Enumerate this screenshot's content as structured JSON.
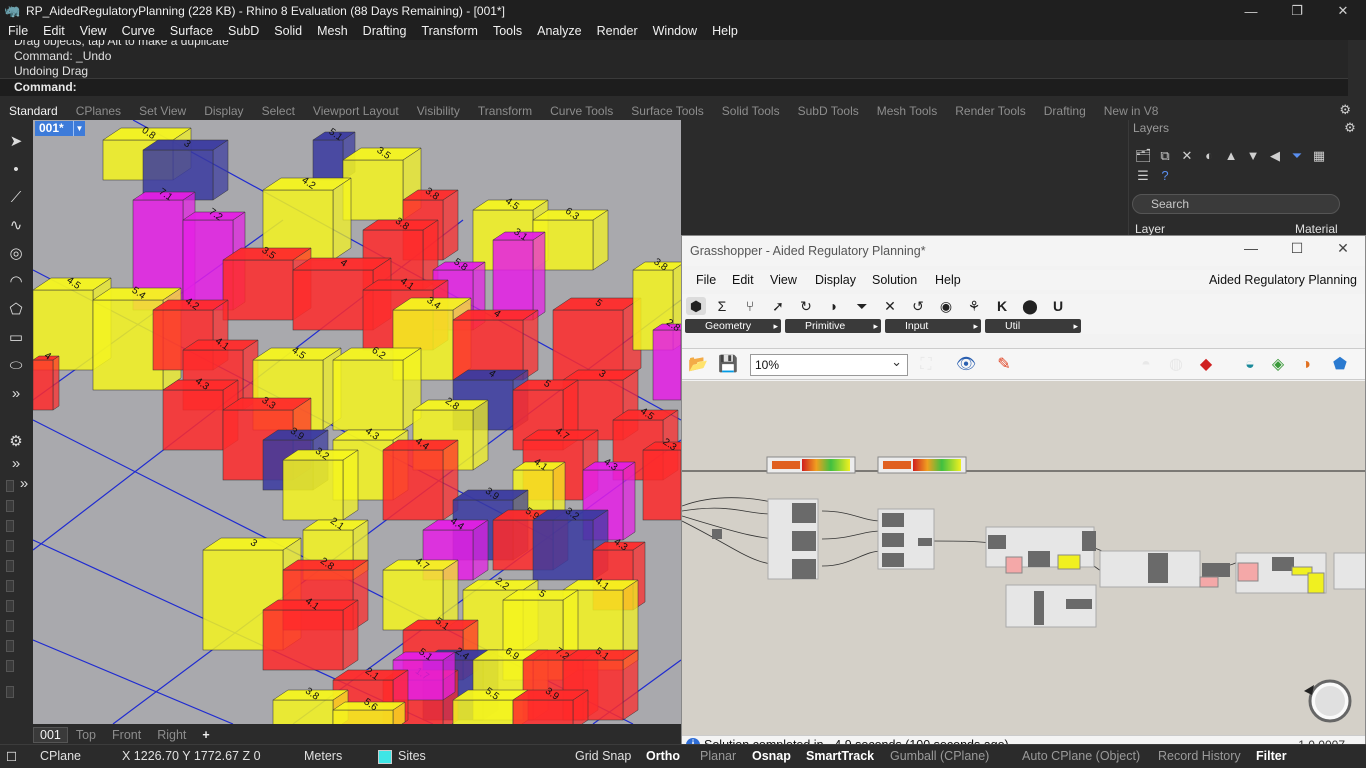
{
  "window": {
    "title": "RP_AidedRegulatoryPlanning (228 KB) - Rhino 8 Evaluation (88 Days Remaining) - [001*]",
    "minimize": "—",
    "restore": "❐",
    "close": "✕"
  },
  "menu": [
    "File",
    "Edit",
    "View",
    "Curve",
    "Surface",
    "SubD",
    "Solid",
    "Mesh",
    "Drafting",
    "Transform",
    "Tools",
    "Analyze",
    "Render",
    "Window",
    "Help"
  ],
  "command": {
    "history": [
      "Drag objects, tap Alt to make a duplicate",
      "Command: _Undo",
      "Undoing Drag"
    ],
    "prompt": "Command:"
  },
  "toolbar_tabs": [
    "Standard",
    "CPlanes",
    "Set View",
    "Display",
    "Select",
    "Viewport Layout",
    "Visibility",
    "Transform",
    "Curve Tools",
    "Surface Tools",
    "Solid Tools",
    "SubD Tools",
    "Mesh Tools",
    "Render Tools",
    "Drafting",
    "New in V8"
  ],
  "viewport": {
    "name": "001*",
    "tabs": [
      "001",
      "Top",
      "Front",
      "Right"
    ],
    "add_tab": "+",
    "building_labels": [
      "0.8",
      "3",
      "5.1",
      "3.5",
      "7.1",
      "7.2",
      "4.2",
      "3.8",
      "3.8",
      "4.5",
      "6.3",
      "3.1",
      "3.5",
      "4",
      "5.8",
      "4.1",
      "4.5",
      "5.4",
      "4.2",
      "3.4",
      "4",
      "5",
      "3.8",
      "2.8",
      "4.1",
      "4.5",
      "6.2",
      "4",
      "3",
      "5",
      "4.3",
      "3.3",
      "2.8",
      "4.7",
      "4.5",
      "4.3",
      "3.9",
      "3.2",
      "4.4",
      "4.1",
      "4.3",
      "2.3",
      "3.9",
      "5.9",
      "4.4",
      "3.2",
      "4.3",
      "2.1",
      "3",
      "2.8",
      "4.1",
      "4.7",
      "2.2",
      "4.1",
      "5",
      "5.1",
      "2.4",
      "1.7",
      "5.1",
      "2.1",
      "6.9",
      "7.2",
      "5.1",
      "3.8",
      "5.6",
      "5.5",
      "3.9",
      "4"
    ]
  },
  "status_bar": {
    "cplane": "CPlane",
    "coords": "X 1226.70 Y 1772.67 Z 0",
    "units": "Meters",
    "layer": "Sites",
    "layer_color": "#3ee6e6",
    "grid_snap": "Grid Snap",
    "ortho": "Ortho",
    "planar": "Planar",
    "osnap": "Osnap",
    "smarttrack": "SmartTrack",
    "gumball": "Gumball (CPlane)",
    "auto_cplane": "Auto CPlane (Object)",
    "record_history": "Record History",
    "filter": "Filter"
  },
  "layers_panel": {
    "title": "Layers",
    "search_placeholder": "Search",
    "col_layer": "Layer",
    "col_material": "Material"
  },
  "grasshopper": {
    "title": "Grasshopper - Aided Regulatory Planning*",
    "menu": [
      "File",
      "Edit",
      "View",
      "Display",
      "Solution",
      "Help"
    ],
    "document_name": "Aided Regulatory Planning",
    "categories": [
      "Geometry",
      "Primitive",
      "Input",
      "Util"
    ],
    "zoom": "10%",
    "status_message": "Solution completed in ~4.9 seconds (100 seconds ago)",
    "version": "1.0.0007"
  },
  "colors": {
    "accent_blue": "#3d7bd9",
    "building_red": "#ff2a2a",
    "building_yellow": "#f5f51e",
    "building_magenta": "#e51ee5",
    "building_blue": "#3a3aa0"
  }
}
